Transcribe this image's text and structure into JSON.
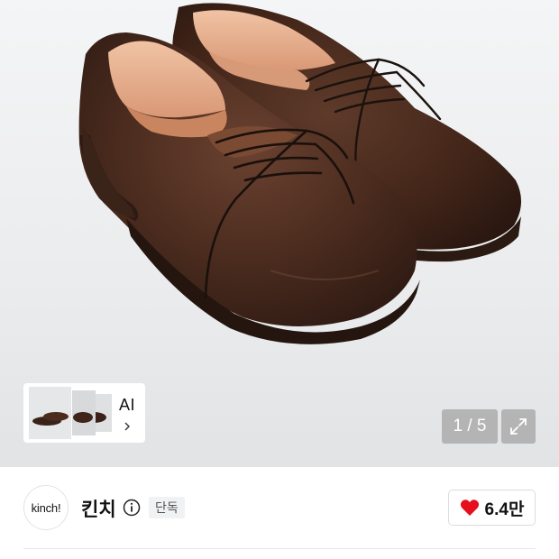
{
  "gallery": {
    "image_alt": "Brown leather lace-up shoes",
    "ai_card": {
      "label": "AI"
    },
    "counter": "1 / 5",
    "expand_icon": "expand-icon"
  },
  "brand": {
    "logo_text": "kinch!",
    "name": "킨치",
    "badge": "단독",
    "likes": "6.4만",
    "colors": {
      "heart": "#e60f1e",
      "leather": "#4a2b1e"
    }
  }
}
